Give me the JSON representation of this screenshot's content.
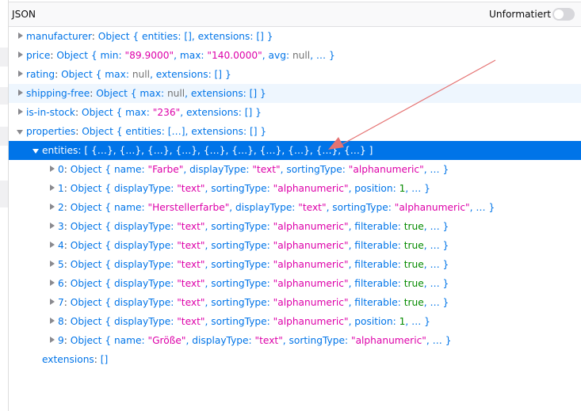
{
  "header": {
    "title": "JSON",
    "toggle_label": "Unformatiert",
    "toggle_on": false
  },
  "colors": {
    "key": "#0074e8",
    "string": "#dd00a9",
    "number": "#058b00",
    "selected_bg": "#0074e8",
    "annotation_arrow": "#e57373"
  },
  "rows": [
    {
      "level": 0,
      "twisty": "closed",
      "tokens": [
        [
          "k",
          "manufacturer"
        ],
        [
          "p",
          ": "
        ],
        [
          "k",
          "Object { entities: [], extensions: [] }"
        ]
      ]
    },
    {
      "level": 0,
      "twisty": "closed",
      "tokens": [
        [
          "k",
          "price"
        ],
        [
          "p",
          ": "
        ],
        [
          "k",
          "Object { min: "
        ],
        [
          "s",
          "\"89.9000\""
        ],
        [
          "k",
          ", max: "
        ],
        [
          "s",
          "\"140.0000\""
        ],
        [
          "k",
          ", avg: "
        ],
        [
          "g",
          "null"
        ],
        [
          "k",
          ", … }"
        ]
      ]
    },
    {
      "level": 0,
      "twisty": "closed",
      "tokens": [
        [
          "k",
          "rating"
        ],
        [
          "p",
          ": "
        ],
        [
          "k",
          "Object { max: "
        ],
        [
          "g",
          "null"
        ],
        [
          "k",
          ", extensions: [] }"
        ]
      ]
    },
    {
      "level": 0,
      "twisty": "closed",
      "hover": true,
      "tokens": [
        [
          "k",
          "shipping-free"
        ],
        [
          "p",
          ": "
        ],
        [
          "k",
          "Object { max: "
        ],
        [
          "g",
          "null"
        ],
        [
          "k",
          ", extensions: [] }"
        ]
      ]
    },
    {
      "level": 0,
      "twisty": "closed",
      "tokens": [
        [
          "k",
          "is-in-stock"
        ],
        [
          "p",
          ": "
        ],
        [
          "k",
          "Object { max: "
        ],
        [
          "s",
          "\"236\""
        ],
        [
          "k",
          ", extensions: [] }"
        ]
      ]
    },
    {
      "level": 0,
      "twisty": "open",
      "tokens": [
        [
          "k",
          "properties"
        ],
        [
          "p",
          ": "
        ],
        [
          "k",
          "Object { entities: […], extensions: [] }"
        ]
      ]
    },
    {
      "level": 1,
      "twisty": "open",
      "selected": true,
      "tokens": [
        [
          "k",
          "entities"
        ],
        [
          "p",
          ": "
        ],
        [
          "k",
          "[ {…}, {…}, {…}, {…}, {…}, {…}, {…}, {…}, {…}, {…} ]"
        ]
      ]
    },
    {
      "level": 2,
      "twisty": "closed",
      "tokens": [
        [
          "k",
          "0"
        ],
        [
          "p",
          ": "
        ],
        [
          "k",
          "Object { name: "
        ],
        [
          "s",
          "\"Farbe\""
        ],
        [
          "k",
          ", displayType: "
        ],
        [
          "s",
          "\"text\""
        ],
        [
          "k",
          ", sortingType: "
        ],
        [
          "s",
          "\"alphanumeric\""
        ],
        [
          "k",
          ", … }"
        ]
      ]
    },
    {
      "level": 2,
      "twisty": "closed",
      "tokens": [
        [
          "k",
          "1"
        ],
        [
          "p",
          ": "
        ],
        [
          "k",
          "Object { displayType: "
        ],
        [
          "s",
          "\"text\""
        ],
        [
          "k",
          ", sortingType: "
        ],
        [
          "s",
          "\"alphanumeric\""
        ],
        [
          "k",
          ", position: "
        ],
        [
          "n",
          "1"
        ],
        [
          "k",
          ", … }"
        ]
      ]
    },
    {
      "level": 2,
      "twisty": "closed",
      "tokens": [
        [
          "k",
          "2"
        ],
        [
          "p",
          ": "
        ],
        [
          "k",
          "Object { name: "
        ],
        [
          "s",
          "\"Herstellerfarbe\""
        ],
        [
          "k",
          ", displayType: "
        ],
        [
          "s",
          "\"text\""
        ],
        [
          "k",
          ", sortingType: "
        ],
        [
          "s",
          "\"alphanumeric\""
        ],
        [
          "k",
          ", … }"
        ]
      ]
    },
    {
      "level": 2,
      "twisty": "closed",
      "tokens": [
        [
          "k",
          "3"
        ],
        [
          "p",
          ": "
        ],
        [
          "k",
          "Object { displayType: "
        ],
        [
          "s",
          "\"text\""
        ],
        [
          "k",
          ", sortingType: "
        ],
        [
          "s",
          "\"alphanumeric\""
        ],
        [
          "k",
          ", filterable: "
        ],
        [
          "n",
          "true"
        ],
        [
          "k",
          ", … }"
        ]
      ]
    },
    {
      "level": 2,
      "twisty": "closed",
      "tokens": [
        [
          "k",
          "4"
        ],
        [
          "p",
          ": "
        ],
        [
          "k",
          "Object { displayType: "
        ],
        [
          "s",
          "\"text\""
        ],
        [
          "k",
          ", sortingType: "
        ],
        [
          "s",
          "\"alphanumeric\""
        ],
        [
          "k",
          ", filterable: "
        ],
        [
          "n",
          "true"
        ],
        [
          "k",
          ", … }"
        ]
      ]
    },
    {
      "level": 2,
      "twisty": "closed",
      "tokens": [
        [
          "k",
          "5"
        ],
        [
          "p",
          ": "
        ],
        [
          "k",
          "Object { displayType: "
        ],
        [
          "s",
          "\"text\""
        ],
        [
          "k",
          ", sortingType: "
        ],
        [
          "s",
          "\"alphanumeric\""
        ],
        [
          "k",
          ", filterable: "
        ],
        [
          "n",
          "true"
        ],
        [
          "k",
          ", … }"
        ]
      ]
    },
    {
      "level": 2,
      "twisty": "closed",
      "tokens": [
        [
          "k",
          "6"
        ],
        [
          "p",
          ": "
        ],
        [
          "k",
          "Object { displayType: "
        ],
        [
          "s",
          "\"text\""
        ],
        [
          "k",
          ", sortingType: "
        ],
        [
          "s",
          "\"alphanumeric\""
        ],
        [
          "k",
          ", filterable: "
        ],
        [
          "n",
          "true"
        ],
        [
          "k",
          ", … }"
        ]
      ]
    },
    {
      "level": 2,
      "twisty": "closed",
      "tokens": [
        [
          "k",
          "7"
        ],
        [
          "p",
          ": "
        ],
        [
          "k",
          "Object { displayType: "
        ],
        [
          "s",
          "\"text\""
        ],
        [
          "k",
          ", sortingType: "
        ],
        [
          "s",
          "\"alphanumeric\""
        ],
        [
          "k",
          ", filterable: "
        ],
        [
          "n",
          "true"
        ],
        [
          "k",
          ", … }"
        ]
      ]
    },
    {
      "level": 2,
      "twisty": "closed",
      "tokens": [
        [
          "k",
          "8"
        ],
        [
          "p",
          ": "
        ],
        [
          "k",
          "Object { displayType: "
        ],
        [
          "s",
          "\"text\""
        ],
        [
          "k",
          ", sortingType: "
        ],
        [
          "s",
          "\"alphanumeric\""
        ],
        [
          "k",
          ", position: "
        ],
        [
          "n",
          "1"
        ],
        [
          "k",
          ", … }"
        ]
      ]
    },
    {
      "level": 2,
      "twisty": "closed",
      "tokens": [
        [
          "k",
          "9"
        ],
        [
          "p",
          ": "
        ],
        [
          "k",
          "Object { name: "
        ],
        [
          "s",
          "\"Größe\""
        ],
        [
          "k",
          ", displayType: "
        ],
        [
          "s",
          "\"text\""
        ],
        [
          "k",
          ", sortingType: "
        ],
        [
          "s",
          "\"alphanumeric\""
        ],
        [
          "k",
          ", … }"
        ]
      ]
    },
    {
      "level": 1,
      "twisty": "none",
      "tokens": [
        [
          "k",
          "extensions"
        ],
        [
          "p",
          ": "
        ],
        [
          "k",
          "[]"
        ]
      ]
    }
  ]
}
